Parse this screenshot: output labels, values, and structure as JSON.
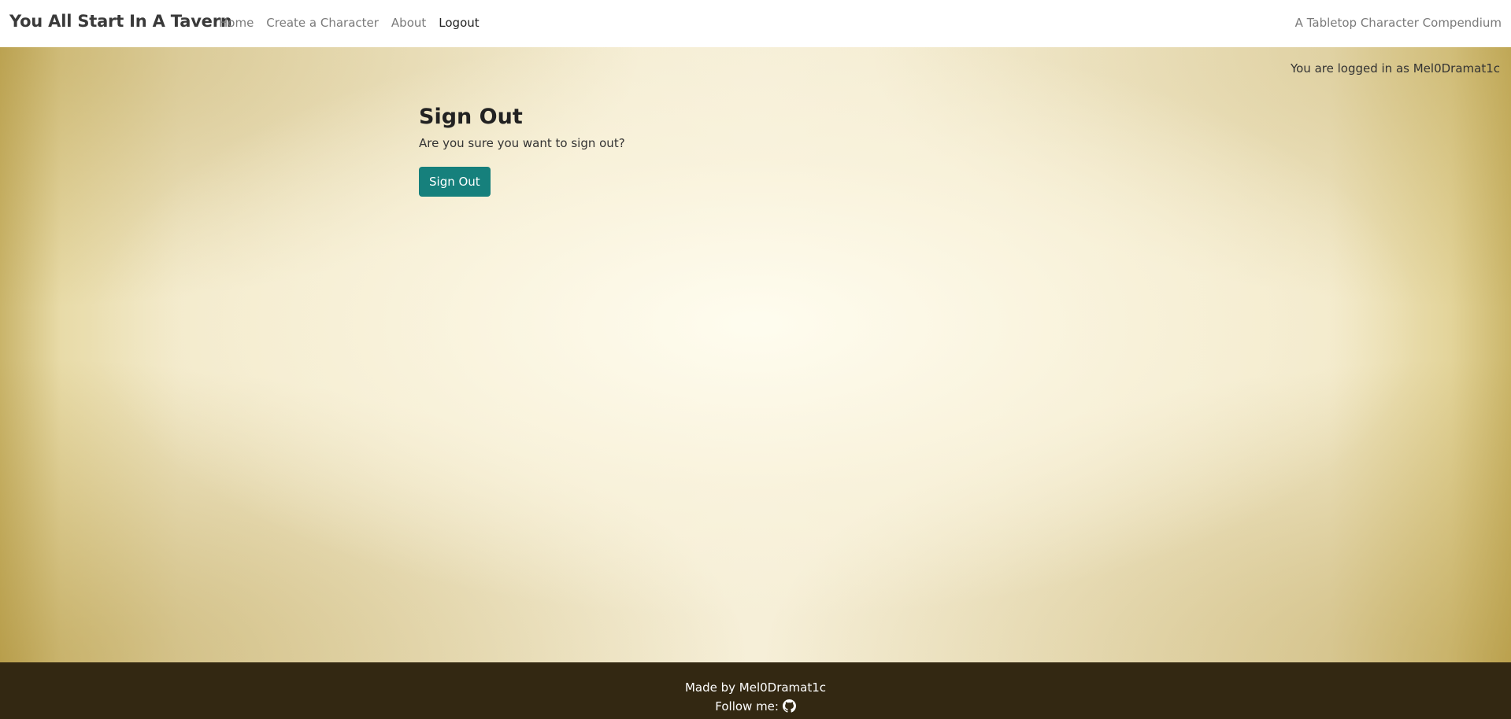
{
  "navbar": {
    "brand": "You All Start In A Tavern",
    "links": [
      {
        "label": "Home"
      },
      {
        "label": "Create a Character"
      },
      {
        "label": "About"
      },
      {
        "label": "Logout"
      }
    ],
    "tagline": "A Tabletop Character Compendium"
  },
  "status": {
    "login_text": "You are logged in as Mel0Dramat1c"
  },
  "main": {
    "title": "Sign Out",
    "text": "Are you sure you want to sign out?",
    "button_label": "Sign Out"
  },
  "footer": {
    "made_by": "Made by Mel0Dramat1c",
    "follow_label": "Follow me:",
    "icon": "github-icon"
  },
  "colors": {
    "accent_button": "#16807c",
    "footer_bg": "#332812",
    "navbar_bg": "#ffffff"
  }
}
